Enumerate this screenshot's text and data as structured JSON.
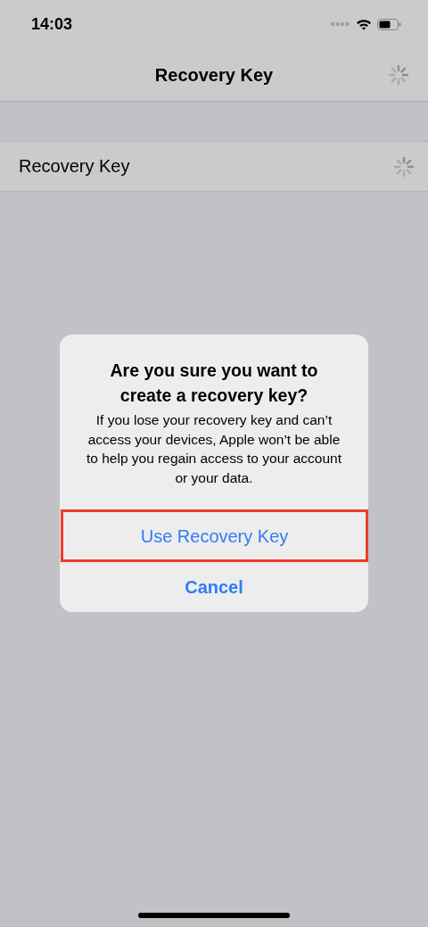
{
  "status_bar": {
    "time": "14:03"
  },
  "nav_bar": {
    "title": "Recovery Key",
    "loading": true
  },
  "list": [
    {
      "label": "Recovery Key",
      "loading": true
    }
  ],
  "alert": {
    "title": "Are you sure you want to create a recovery key?",
    "message": "If you lose your recovery key and can’t access your devices, Apple won’t be able to help you regain access to your account or your data.",
    "buttons": [
      {
        "label": "Use Recovery Key",
        "kind": "default",
        "highlighted": true
      },
      {
        "label": "Cancel",
        "kind": "cancel",
        "highlighted": false
      }
    ]
  }
}
